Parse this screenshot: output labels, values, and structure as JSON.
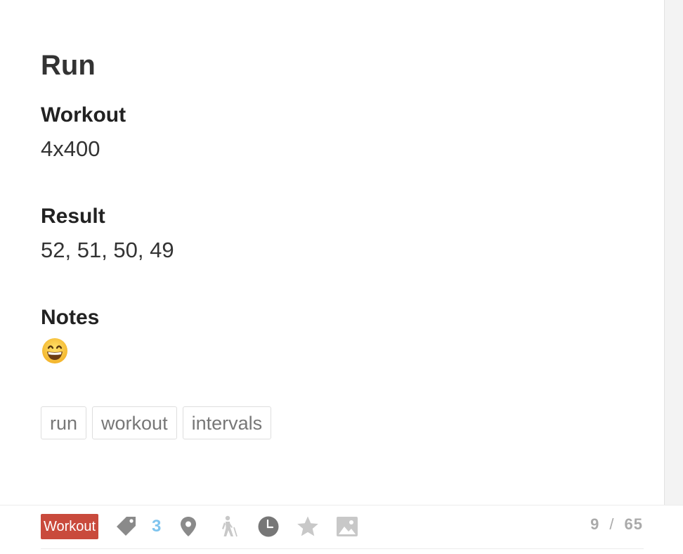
{
  "entry": {
    "title": "Run",
    "sections": [
      {
        "heading": "Workout",
        "value": "4x400"
      },
      {
        "heading": "Result",
        "value": "52, 51, 50, 49"
      },
      {
        "heading": "Notes",
        "value_icon": "grinning-face-emoji"
      }
    ],
    "tags": [
      "run",
      "workout",
      "intervals"
    ]
  },
  "bottom_bar": {
    "type_badge": "Workout",
    "type_badge_color": "#c94a3c",
    "tag_count": "3",
    "tag_count_color": "#7fc4ee",
    "icons": [
      "tag-icon",
      "location-pin-icon",
      "hiker-icon",
      "clock-icon",
      "star-icon",
      "image-icon"
    ],
    "pager": {
      "current": "9",
      "separator": "/",
      "total": "65"
    }
  }
}
